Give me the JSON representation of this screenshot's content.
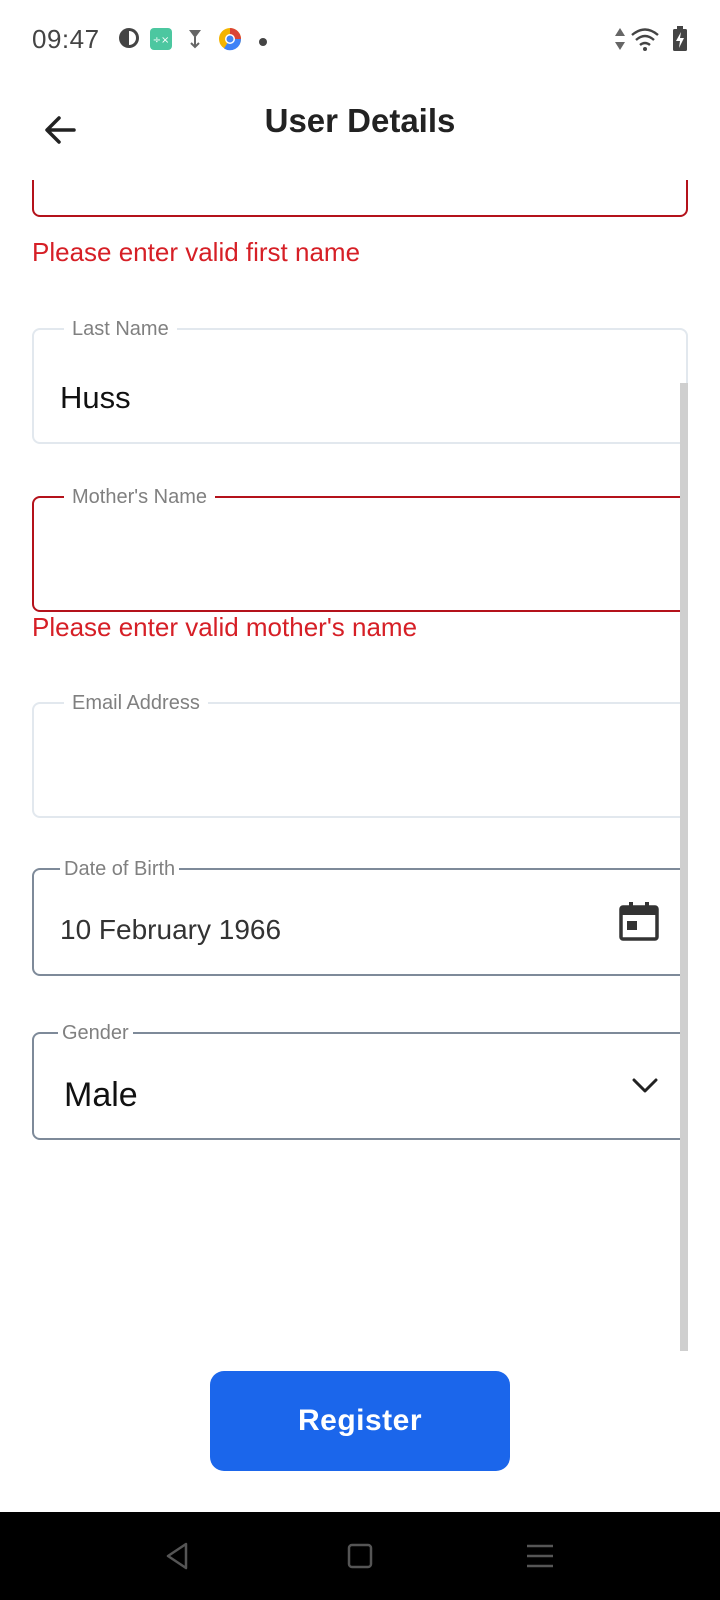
{
  "status_bar": {
    "time": "09:47",
    "icons": [
      "pie-icon",
      "calculator-app-icon",
      "download-icon",
      "chrome-like-icon",
      "dot-icon"
    ],
    "right_icons": [
      "data-arrows-icon",
      "wifi-icon",
      "battery-charging-icon"
    ]
  },
  "header": {
    "title": "User Details",
    "back_icon": "back-arrow-icon"
  },
  "form": {
    "first_name": {
      "error": "Please enter valid first name"
    },
    "last_name": {
      "label": "Last Name",
      "value": "Huss"
    },
    "mothers_name": {
      "label": "Mother's Name",
      "value": "",
      "error": "Please enter valid mother's name"
    },
    "email": {
      "label": "Email Address",
      "value": ""
    },
    "dob": {
      "label": "Date of Birth",
      "value": "10 February 1966",
      "icon": "calendar-icon"
    },
    "gender": {
      "label": "Gender",
      "value": "Male",
      "icon": "chevron-down-icon"
    }
  },
  "actions": {
    "register_label": "Register"
  },
  "colors": {
    "primary": "#1b66eb",
    "error": "#d61f26",
    "error_border": "#b4121b",
    "outline": "#7e8a99"
  },
  "nav": {
    "icons": [
      "back-triangle-icon",
      "home-square-icon",
      "menu-lines-icon"
    ]
  }
}
